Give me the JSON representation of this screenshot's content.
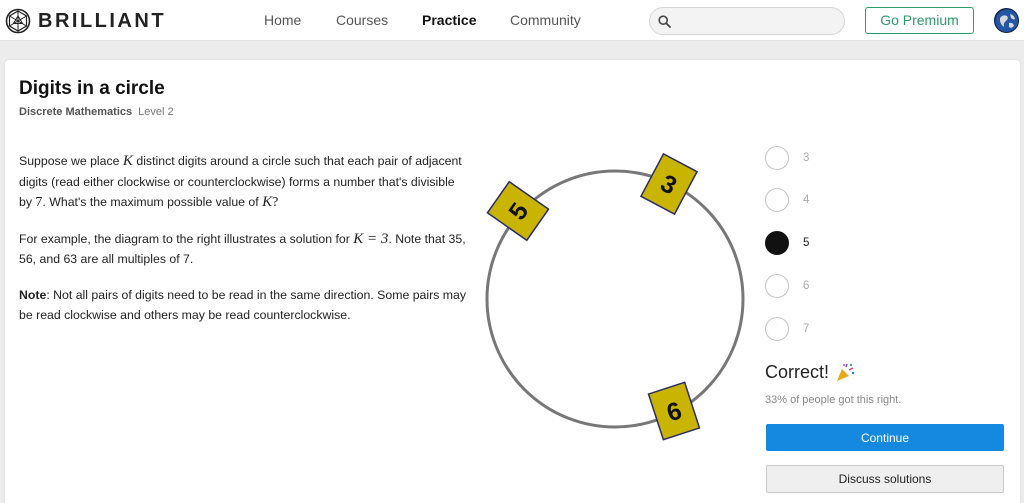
{
  "nav": {
    "brand": "BRILLIANT",
    "links": [
      {
        "label": "Home"
      },
      {
        "label": "Courses"
      },
      {
        "label": "Practice",
        "active": true
      },
      {
        "label": "Community"
      }
    ],
    "search_placeholder": "",
    "premium_label": "Go Premium",
    "icons": {
      "logo": "brilliant-logo-icon",
      "search": "search-icon",
      "avatar": "user-avatar"
    }
  },
  "problem": {
    "title": "Digits in a circle",
    "subject": "Discrete Mathematics",
    "level": "Level 2",
    "p1_a": "Suppose we place",
    "p1_var": "K",
    "p1_b": "distinct digits around a circle such that each pair of adjacent digits (read either clockwise or counterclockwise) forms a number that's divisible by",
    "p1_num": "7",
    "p1_c": ". What's the maximum possible value of",
    "p1_var2": "K",
    "p1_end": "?",
    "p2_a": "For example, the diagram to the right illustrates a solution for",
    "p2_math": "K = 3",
    "p2_b": ". Note that 35, 56, and 63 are all multiples of 7.",
    "note_label": "Note",
    "note_text": ": Not all pairs of digits need to be read in the same direction. Some pairs may be read clockwise and others may be read counterclockwise."
  },
  "diagram": {
    "tiles": [
      {
        "digit": "3"
      },
      {
        "digit": "5"
      },
      {
        "digit": "6"
      }
    ],
    "tile_color": "#c9b400",
    "circle_color": "#777777"
  },
  "answers": {
    "options": [
      {
        "label": "3",
        "selected": false
      },
      {
        "label": "4",
        "selected": false
      },
      {
        "label": "5",
        "selected": true
      },
      {
        "label": "6",
        "selected": false
      },
      {
        "label": "7",
        "selected": false
      }
    ],
    "result": "Correct!",
    "result_icon": "party-popper-icon",
    "stat": "33% of people got this right.",
    "continue_label": "Continue",
    "discuss_label": "Discuss solutions"
  },
  "colors": {
    "accent_green": "#2e9b6c",
    "button_blue": "#1589e0"
  }
}
